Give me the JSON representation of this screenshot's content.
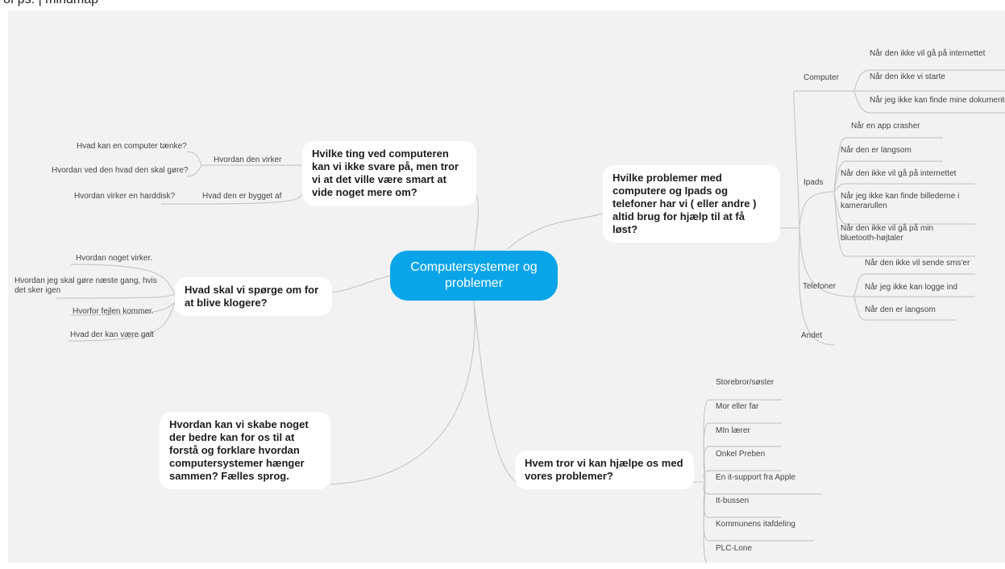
{
  "partial_title": "of ps. | mindmap",
  "center": "Computersystemer og problemer",
  "topics": {
    "ting": {
      "title": "Hvilke ting ved computeren kan vi ikke svare på, men tror vi at det ville være smart at vide noget mere om?",
      "sub1": "Hvordan den virker",
      "sub1_items": [
        "Hvad kan en computer tænke?",
        "Hvordan ved den hvad den skal gøre?"
      ],
      "sub2": "Hvad den er bygget af",
      "sub2_items": [
        "Hvordan virker en harddisk?"
      ]
    },
    "sporge": {
      "title": "Hvad skal vi spørge om for at blive klogere?",
      "items": [
        "Hvordan noget virker.",
        "Hvordan jeg skal gøre næste gang, hvis det sker igen",
        "Hvorfor fejlen kommer.",
        "Hvad der kan være galt"
      ]
    },
    "skabe": {
      "title": "Hvordan kan vi skabe noget der bedre kan for os til at forstå og forklare hvordan computersystemer hænger sammen? Fælles sprog."
    },
    "problemer": {
      "title": "Hvilke problemer med computere og Ipads og telefoner har vi ( eller andre ) altid brug for hjælp til at få løst?",
      "computer": "Computer",
      "computer_items": [
        "Når den ikke vil gå på internettet",
        "Når den ikke vi starte",
        "Når jeg ikke kan finde mine dokumenter"
      ],
      "ipads": "Ipads",
      "ipads_items": [
        "Når en app crasher",
        "Når den er langsom",
        "Når den ikke vil gå på internettet",
        "Når jeg ikke kan finde billederne i kamerarullen",
        "Når den ikke vil gå på min bluetooth-højtaler"
      ],
      "telefoner": "Telefoner",
      "telefoner_items": [
        "Når den ikke vil sende sms'er",
        "Når jeg ikke kan logge ind",
        "Når den er langsom"
      ],
      "andet": "Andet"
    },
    "hjaelpe": {
      "title": "Hvem tror vi kan hjælpe os med vores problemer?",
      "items": [
        "Storebror/søster",
        "Mor eller far",
        "MIn lærer",
        "Onkel Preben",
        "En it-support fra Apple",
        "It-bussen",
        "Kommunens itafdeling",
        "PLC-Lone"
      ]
    }
  },
  "colors": {
    "center": "#0aa5e8",
    "line": "#c9c9c9",
    "background": "#f2f2f2"
  }
}
